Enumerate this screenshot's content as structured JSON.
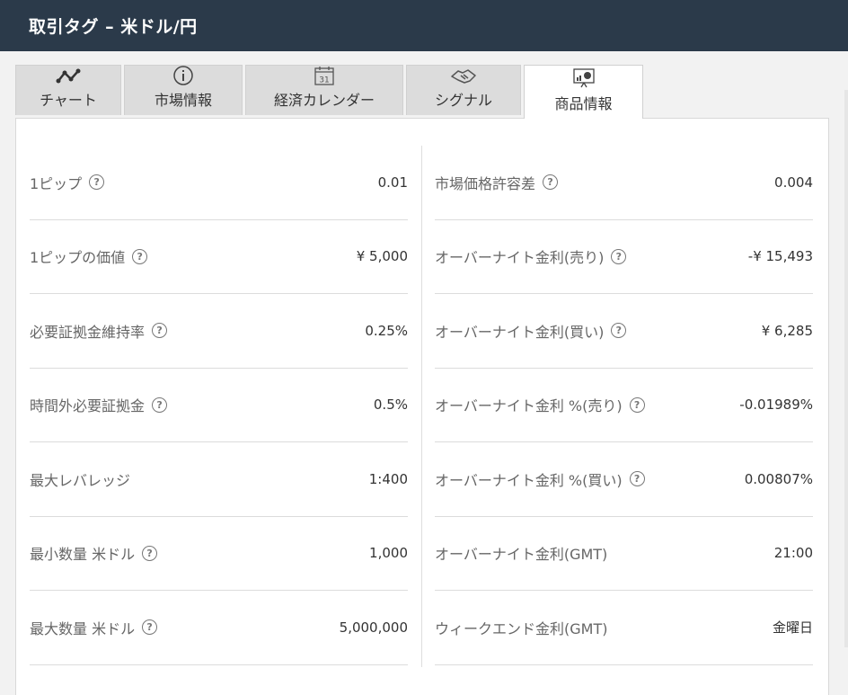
{
  "window": {
    "title": "取引タグ – 米ドル/円"
  },
  "tabs": [
    {
      "label": "チャート",
      "icon": "line-chart-icon"
    },
    {
      "label": "市場情報",
      "icon": "info-icon"
    },
    {
      "label": "経済カレンダー",
      "icon": "calendar-icon",
      "calendar_day": "31"
    },
    {
      "label": "シグナル",
      "icon": "handshake-icon"
    },
    {
      "label": "商品情報",
      "icon": "presentation-icon",
      "active": true
    }
  ],
  "help_glyph": "?",
  "left_rows": [
    {
      "label": "1ピップ",
      "value": "0.01",
      "help": true
    },
    {
      "label": "1ピップの価値",
      "value": "¥ 5,000",
      "help": true
    },
    {
      "label": "必要証拠金維持率",
      "value": "0.25%",
      "help": true
    },
    {
      "label": "時間外必要証拠金",
      "value": "0.5%",
      "help": true
    },
    {
      "label": "最大レバレッジ",
      "value": "1:400",
      "help": false
    },
    {
      "label": "最小数量 米ドル",
      "value": "1,000",
      "help": true
    },
    {
      "label": "最大数量 米ドル",
      "value": "5,000,000",
      "help": true
    }
  ],
  "right_rows": [
    {
      "label": "市場価格許容差",
      "value": "0.004",
      "help": true
    },
    {
      "label": "オーバーナイト金利(売り)",
      "value": "-¥ 15,493",
      "help": true
    },
    {
      "label": "オーバーナイト金利(買い)",
      "value": "¥ 6,285",
      "help": true
    },
    {
      "label": "オーバーナイト金利 %(売り)",
      "value": "-0.01989%",
      "help": true
    },
    {
      "label": "オーバーナイト金利 %(買い)",
      "value": "0.00807%",
      "help": true
    },
    {
      "label": "オーバーナイト金利(GMT)",
      "value": "21:00",
      "help": false
    },
    {
      "label": "ウィークエンド金利(GMT)",
      "value": "金曜日",
      "help": false
    }
  ],
  "colors": {
    "titlebar": "#2b3a4a",
    "tab_inactive": "#dcdcdc",
    "tab_active": "#ffffff"
  }
}
